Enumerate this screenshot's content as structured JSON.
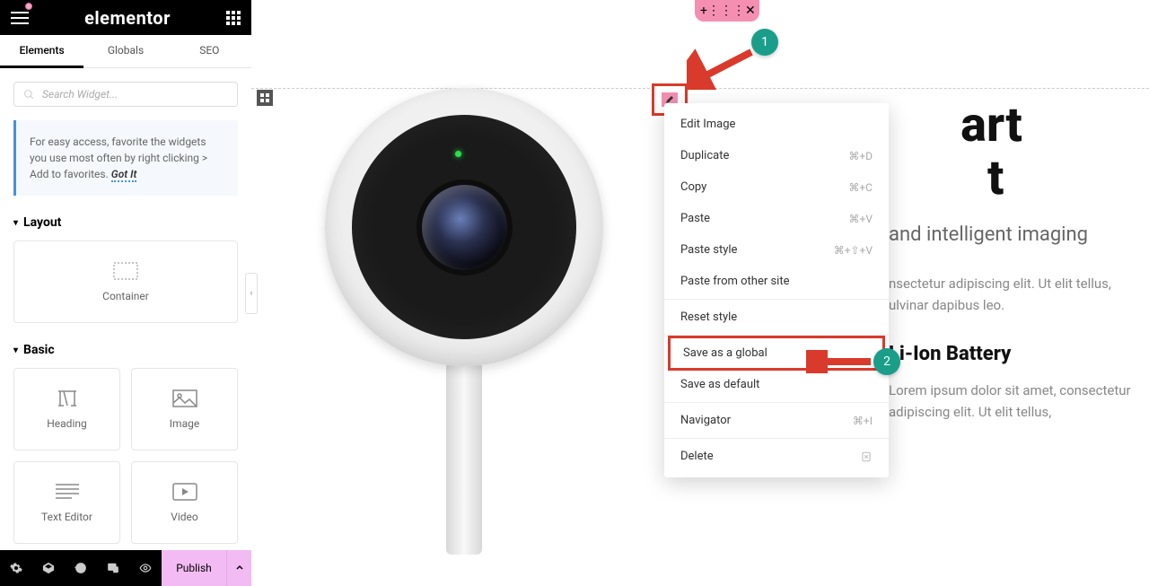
{
  "header": {
    "logo": "elementor"
  },
  "tabs": {
    "elements": "Elements",
    "globals": "Globals",
    "seo": "SEO"
  },
  "search": {
    "placeholder": "Search Widget..."
  },
  "tip": {
    "text": "For easy access, favorite the widgets you use most often by right clicking > Add to favorites.",
    "gotit": "Got It"
  },
  "sections": {
    "layout": {
      "title": "Layout",
      "items": {
        "container": "Container"
      }
    },
    "basic": {
      "title": "Basic",
      "items": {
        "heading": "Heading",
        "image": "Image",
        "text_editor": "Text Editor",
        "video": "Video"
      }
    }
  },
  "footer": {
    "publish": "Publish"
  },
  "context_menu": {
    "edit_image": "Edit Image",
    "duplicate": "Duplicate",
    "duplicate_sc": "⌘+D",
    "copy": "Copy",
    "copy_sc": "⌘+C",
    "paste": "Paste",
    "paste_sc": "⌘+V",
    "paste_style": "Paste style",
    "paste_style_sc": "⌘+⇧+V",
    "paste_other": "Paste from other site",
    "reset_style": "Reset style",
    "save_global": "Save as a global",
    "save_default": "Save as default",
    "navigator": "Navigator",
    "navigator_sc": "⌘+I",
    "delete": "Delete"
  },
  "content": {
    "title_line1": "art",
    "title_line2": "t",
    "subtitle": "and intelligent imaging",
    "para1": "nsectetur adipiscing elit. Ut elit tellus,",
    "para1b": "ulvinar dapibus leo.",
    "h3": "Li-Ion Battery",
    "para2": "Lorem ipsum dolor sit amet, consectetur adipiscing elit. Ut elit tellus,"
  },
  "annotations": {
    "one": "1",
    "two": "2"
  }
}
